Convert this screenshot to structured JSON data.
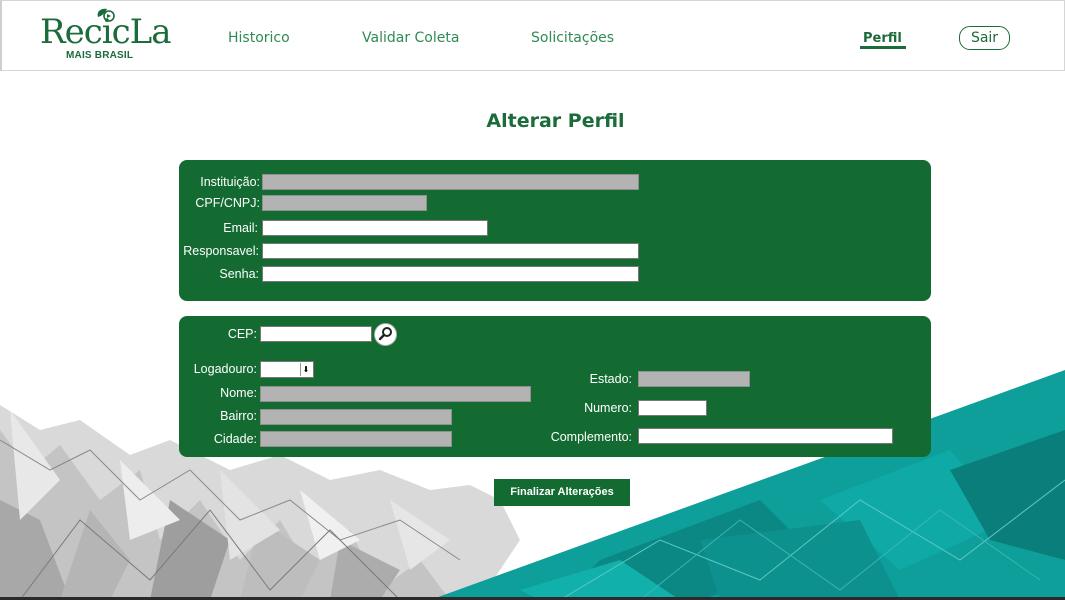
{
  "brand": {
    "name": "RecicLa",
    "subtitle": "MAIS BRASIL",
    "color": "#1c6b3a"
  },
  "nav": {
    "historico": "Historico",
    "validar_coleta": "Validar Coleta",
    "solicitacoes": "Solicitações",
    "perfil": "Perfil",
    "sair": "Sair"
  },
  "page_title": "Alterar Perfil",
  "account_form": {
    "instituicao_label": "Instituição:",
    "cpf_cnpj_label": "CPF/CNPJ:",
    "email_label": "Email:",
    "responsavel_label": "Responsavel:",
    "senha_label": "Senha:"
  },
  "address_form": {
    "cep_label": "CEP:",
    "logadouro_label": "Logadouro:",
    "nome_label": "Nome:",
    "bairro_label": "Bairro:",
    "cidade_label": "Cidade:",
    "estado_label": "Estado:",
    "numero_label": "Numero:",
    "complemento_label": "Complemento:"
  },
  "submit_label": "Finalizar Alterações",
  "colors": {
    "panel": "#146b32",
    "accent_teal": "#0fa0a0",
    "disabled_field": "#b3b3b3"
  }
}
